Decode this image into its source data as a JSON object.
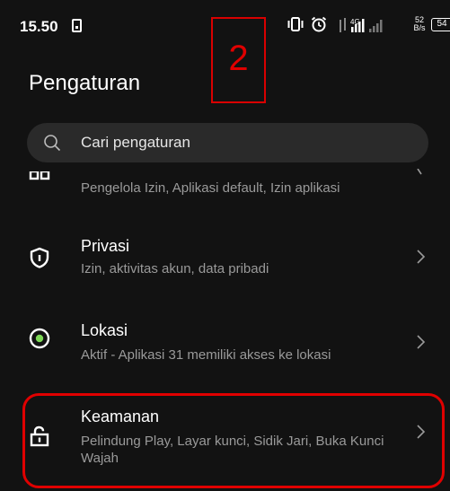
{
  "status_bar": {
    "time": "15.50",
    "network_type": "4G",
    "speed_value": "52",
    "speed_unit": "B/s",
    "battery": "54"
  },
  "annotation": {
    "step_number": "2"
  },
  "header": {
    "title": "Pengaturan"
  },
  "search": {
    "placeholder": "Cari pengaturan"
  },
  "settings_items": [
    {
      "title": "",
      "subtitle": "Pengelola Izin, Aplikasi default, Izin aplikasi",
      "icon": "apps-grid-icon"
    },
    {
      "title": "Privasi",
      "subtitle": "Izin, aktivitas akun, data pribadi",
      "icon": "shield-icon"
    },
    {
      "title": "Lokasi",
      "subtitle": "Aktif - Aplikasi 31 memiliki akses ke lokasi",
      "icon": "location-icon"
    },
    {
      "title": "Keamanan",
      "subtitle": "Pelindung Play, Layar kunci, Sidik Jari, Buka Kunci Wajah",
      "icon": "unlocked-lock-icon"
    }
  ],
  "colors": {
    "background": "#121212",
    "search_background": "#2a2a2a",
    "annotation_red": "#e00000",
    "subtitle_gray": "#9a9a9a"
  }
}
